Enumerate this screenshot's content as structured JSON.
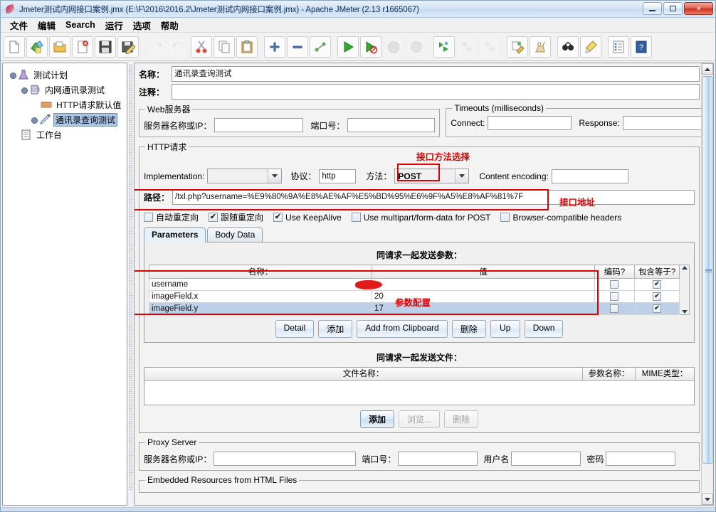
{
  "window": {
    "title": "Jmeter测试内网接口案例.jmx (E:\\F\\2016\\2016.2\\Jmeter测试内网接口案例.jmx) - Apache JMeter (2.13 r1665067)",
    "minimize_label": "",
    "maximize_label": "",
    "close_label": "✕"
  },
  "menu": {
    "items": [
      {
        "label": "文件"
      },
      {
        "label": "编辑"
      },
      {
        "label": "Search"
      },
      {
        "label": "运行"
      },
      {
        "label": "选项"
      },
      {
        "label": "帮助"
      }
    ]
  },
  "toolbar": {
    "buttons": [
      {
        "name": "new-icon"
      },
      {
        "name": "templates-icon"
      },
      {
        "name": "open-icon"
      },
      {
        "name": "close-icon"
      },
      {
        "name": "save-icon"
      },
      {
        "name": "save-as-icon"
      },
      {
        "name": "undo-icon"
      },
      {
        "name": "redo-icon"
      },
      {
        "name": "cut-icon"
      },
      {
        "name": "copy-icon"
      },
      {
        "name": "paste-icon"
      },
      {
        "name": "expand-all-icon"
      },
      {
        "name": "collapse-all-icon"
      },
      {
        "name": "toggle-icon"
      },
      {
        "name": "start-icon"
      },
      {
        "name": "start-no-pause-icon"
      },
      {
        "name": "stop-icon"
      },
      {
        "name": "shutdown-icon"
      },
      {
        "name": "remote-start-all-icon"
      },
      {
        "name": "remote-stop-all-icon"
      },
      {
        "name": "remote-shutdown-all-icon"
      },
      {
        "name": "clear-icon"
      },
      {
        "name": "clear-all-icon"
      },
      {
        "name": "search-icon"
      },
      {
        "name": "search-reset-icon"
      },
      {
        "name": "function-helper-icon"
      },
      {
        "name": "help-icon"
      }
    ]
  },
  "tree": {
    "nodes": [
      {
        "label": "测试计划",
        "icon": "test-plan-icon",
        "depth": 0,
        "selected": false
      },
      {
        "label": "内网通讯录测试",
        "icon": "thread-group-icon",
        "depth": 1,
        "selected": false
      },
      {
        "label": "HTTP请求默认值",
        "icon": "http-defaults-icon",
        "depth": 2,
        "selected": false
      },
      {
        "label": "通讯录查询测试",
        "icon": "http-sampler-icon",
        "depth": 2,
        "selected": true
      },
      {
        "label": "工作台",
        "icon": "workbench-icon",
        "depth": 0,
        "selected": false
      }
    ]
  },
  "sampler": {
    "name_label": "名称：",
    "name_value": "通讯录查询测试",
    "comment_label": "注释：",
    "comment_value": "",
    "web_server": {
      "legend": "Web服务器",
      "server_label": "服务器名称或IP：",
      "server_value": "",
      "port_label": "端口号：",
      "port_value": ""
    },
    "timeouts": {
      "legend": "Timeouts (milliseconds)",
      "connect_label": "Connect:",
      "connect_value": "",
      "response_label": "Response:",
      "response_value": ""
    },
    "http_request": {
      "legend": "HTTP请求",
      "implementation_label": "Implementation:",
      "implementation_value": "",
      "protocol_label": "协议：",
      "protocol_value": "http",
      "method_label": "方法：",
      "method_value": "POST",
      "content_encoding_label": "Content encoding:",
      "content_encoding_value": "",
      "path_label": "路径：",
      "path_value": "/txl.php?username=%E9%80%9A%E8%AE%AF%E5%BD%95%E6%9F%A5%E8%AF%81%7F",
      "checkboxes": [
        {
          "label": "自动重定向",
          "checked": false
        },
        {
          "label": "跟随重定向",
          "checked": true
        },
        {
          "label": "Use KeepAlive",
          "checked": true
        },
        {
          "label": "Use multipart/form-data for POST",
          "checked": false
        },
        {
          "label": "Browser-compatible headers",
          "checked": false
        }
      ]
    },
    "tabs": [
      {
        "label": "Parameters",
        "active": true
      },
      {
        "label": "Body Data",
        "active": false
      }
    ],
    "params": {
      "title": "同请求一起发送参数：",
      "columns": [
        "名称：",
        "值",
        "编码?",
        "包含等于?"
      ],
      "rows": [
        {
          "name": "username",
          "value": "",
          "encode": false,
          "include_equals": true,
          "selected": false,
          "redacted": true
        },
        {
          "name": "imageField.x",
          "value": "20",
          "encode": false,
          "include_equals": true,
          "selected": false,
          "redacted": false
        },
        {
          "name": "imageField.y",
          "value": "17",
          "encode": false,
          "include_equals": true,
          "selected": true,
          "redacted": false
        }
      ],
      "buttons": [
        {
          "label": "Detail",
          "disabled": false
        },
        {
          "label": "添加",
          "disabled": false
        },
        {
          "label": "Add from Clipboard",
          "disabled": false
        },
        {
          "label": "删除",
          "disabled": false
        },
        {
          "label": "Up",
          "disabled": false
        },
        {
          "label": "Down",
          "disabled": false
        }
      ]
    },
    "files": {
      "title": "同请求一起发送文件：",
      "columns": [
        "文件名称：",
        "参数名称：",
        "MIME类型："
      ],
      "buttons": [
        {
          "label": "添加",
          "disabled": false,
          "primary": true
        },
        {
          "label": "浏览...",
          "disabled": true,
          "primary": false
        },
        {
          "label": "删除",
          "disabled": true,
          "primary": false
        }
      ]
    },
    "proxy": {
      "legend": "Proxy Server",
      "server_label": "服务器名称或IP：",
      "server_value": "",
      "port_label": "端口号：",
      "port_value": "",
      "user_label": "用户名",
      "user_value": "",
      "password_label": "密码",
      "password_value": ""
    },
    "embedded": {
      "legend": "Embedded Resources from HTML Files"
    }
  },
  "annotations": [
    {
      "text": "接口方法选择",
      "name": "annotation-method-select"
    },
    {
      "text": "接口地址",
      "name": "annotation-interface-url"
    },
    {
      "text": "参数配置",
      "name": "annotation-param-config"
    }
  ],
  "colors": {
    "annotation_red": "#e00000",
    "title_text": "#12305a",
    "selection_blue": "#a9c5e8"
  }
}
